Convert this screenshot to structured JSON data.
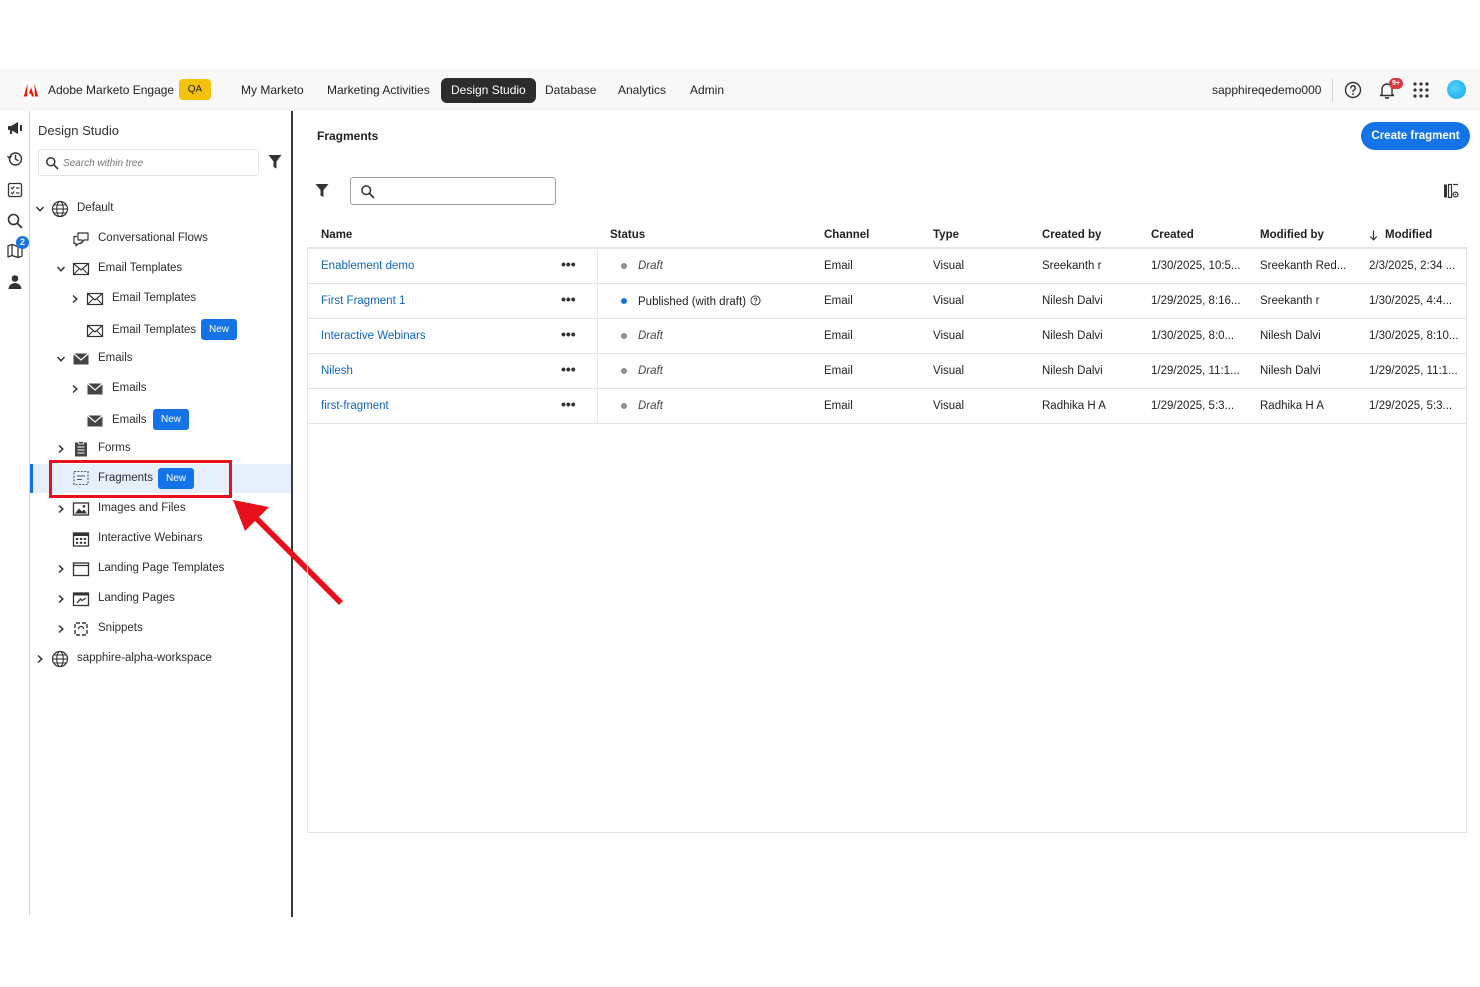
{
  "header": {
    "brand": "Adobe Marketo Engage",
    "env_badge": "QA",
    "nav": [
      "My Marketo",
      "Marketing Activities",
      "Design Studio",
      "Database",
      "Analytics",
      "Admin"
    ],
    "active_nav": "Design Studio",
    "user": "sapphireqedemo000",
    "notification_count": "9+"
  },
  "rail": {
    "badge_count": "2"
  },
  "tree": {
    "title": "Design Studio",
    "search_placeholder": "Search within tree",
    "items": [
      {
        "label": "Default",
        "icon": "globe-icon",
        "level": 0,
        "chevron": "down"
      },
      {
        "label": "Conversational Flows",
        "icon": "chat-icon",
        "level": 1,
        "chevron": "none"
      },
      {
        "label": "Email Templates",
        "icon": "email-template-icon",
        "level": 1,
        "chevron": "down"
      },
      {
        "label": "Email Templates",
        "icon": "email-template-icon",
        "level": 2,
        "chevron": "right"
      },
      {
        "label": "Email Templates",
        "icon": "email-template-icon",
        "level": 2,
        "chevron": "none",
        "badge": "New"
      },
      {
        "label": "Emails",
        "icon": "email-icon",
        "level": 1,
        "chevron": "down"
      },
      {
        "label": "Emails",
        "icon": "email-icon",
        "level": 2,
        "chevron": "right"
      },
      {
        "label": "Emails",
        "icon": "email-icon",
        "level": 2,
        "chevron": "none",
        "badge": "New"
      },
      {
        "label": "Forms",
        "icon": "form-icon",
        "level": 1,
        "chevron": "right"
      },
      {
        "label": "Fragments",
        "icon": "fragment-icon",
        "level": 1,
        "chevron": "none",
        "badge": "New",
        "selected": true
      },
      {
        "label": "Images and Files",
        "icon": "image-icon",
        "level": 1,
        "chevron": "right"
      },
      {
        "label": "Interactive Webinars",
        "icon": "calendar-icon",
        "level": 1,
        "chevron": "none"
      },
      {
        "label": "Landing Page Templates",
        "icon": "page-template-icon",
        "level": 1,
        "chevron": "right"
      },
      {
        "label": "Landing Pages",
        "icon": "landing-page-icon",
        "level": 1,
        "chevron": "right"
      },
      {
        "label": "Snippets",
        "icon": "snippet-icon",
        "level": 1,
        "chevron": "right"
      },
      {
        "label": "sapphire-alpha-workspace",
        "icon": "globe-icon",
        "level": 0,
        "chevron": "right"
      }
    ]
  },
  "main": {
    "title": "Fragments",
    "create_button": "Create fragment",
    "search_value": "",
    "columns": [
      "Name",
      "Status",
      "Channel",
      "Type",
      "Created by",
      "Created",
      "Modified by",
      "Modified"
    ],
    "sort_column": "Modified",
    "rows": [
      {
        "name": "Enablement demo",
        "status": "Draft",
        "channel": "Email",
        "type": "Visual",
        "created_by": "Sreekanth r",
        "created": "1/30/2025, 10:5...",
        "modified_by": "Sreekanth Red...",
        "modified": "2/3/2025, 2:34 ..."
      },
      {
        "name": "First Fragment 1",
        "status": "Published (with draft)",
        "channel": "Email",
        "type": "Visual",
        "created_by": "Nilesh Dalvi",
        "created": "1/29/2025, 8:16...",
        "modified_by": "Sreekanth r",
        "modified": "1/30/2025, 4:4..."
      },
      {
        "name": "Interactive Webinars",
        "status": "Draft",
        "channel": "Email",
        "type": "Visual",
        "created_by": "Nilesh Dalvi",
        "created": "1/30/2025, 8:0...",
        "modified_by": "Nilesh Dalvi",
        "modified": "1/30/2025, 8:10..."
      },
      {
        "name": "Nilesh",
        "status": "Draft",
        "channel": "Email",
        "type": "Visual",
        "created_by": "Nilesh Dalvi",
        "created": "1/29/2025, 11:1...",
        "modified_by": "Nilesh Dalvi",
        "modified": "1/29/2025, 11:1..."
      },
      {
        "name": "first-fragment",
        "status": "Draft",
        "channel": "Email",
        "type": "Visual",
        "created_by": "Radhika H A",
        "created": "1/29/2025, 5:3...",
        "modified_by": "Radhika H A",
        "modified": "1/29/2025, 5:3..."
      }
    ]
  },
  "colors": {
    "accent": "#1473e6",
    "highlight": "#e8101b",
    "draft_dot": "#8e8e8e",
    "published_dot": "#1473e6"
  }
}
